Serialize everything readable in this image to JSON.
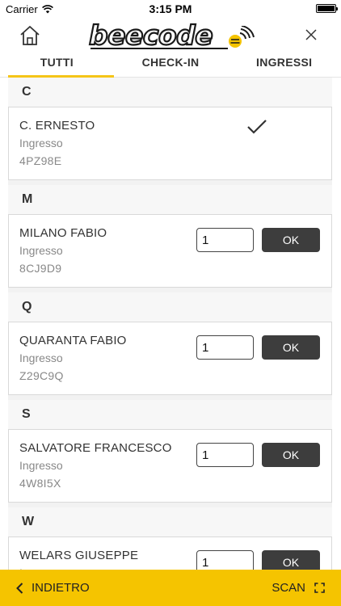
{
  "status_bar": {
    "carrier": "Carrier",
    "time": "3:15 PM"
  },
  "header": {
    "logo_text": "beecode"
  },
  "tabs": [
    {
      "label": "TUTTI",
      "active": true
    },
    {
      "label": "CHECK-IN",
      "active": false
    },
    {
      "label": "INGRESSI",
      "active": false
    }
  ],
  "sections": [
    {
      "letter": "C",
      "entry": {
        "name": "C. ERNESTO",
        "type": "Ingresso",
        "code": "4PZ98E",
        "checked_in": true
      }
    },
    {
      "letter": "M",
      "entry": {
        "name": "MILANO FABIO",
        "type": "Ingresso",
        "code": "8CJ9D9",
        "quantity": "1",
        "ok_label": "OK"
      }
    },
    {
      "letter": "Q",
      "entry": {
        "name": "QUARANTA FABIO",
        "type": "Ingresso",
        "code": "Z29C9Q",
        "quantity": "1",
        "ok_label": "OK"
      }
    },
    {
      "letter": "S",
      "entry": {
        "name": "SALVATORE FRANCESCO",
        "type": "Ingresso",
        "code": "4W8I5X",
        "quantity": "1",
        "ok_label": "OK"
      }
    },
    {
      "letter": "W",
      "entry": {
        "name": "WELARS GIUSEPPE",
        "type": "Ingresso",
        "code": "",
        "quantity": "1",
        "ok_label": "OK"
      }
    }
  ],
  "bottom_bar": {
    "back_label": "INDIETRO",
    "scan_label": "SCAN"
  },
  "colors": {
    "accent": "#f5c400",
    "button_dark": "#3d3d3d"
  }
}
